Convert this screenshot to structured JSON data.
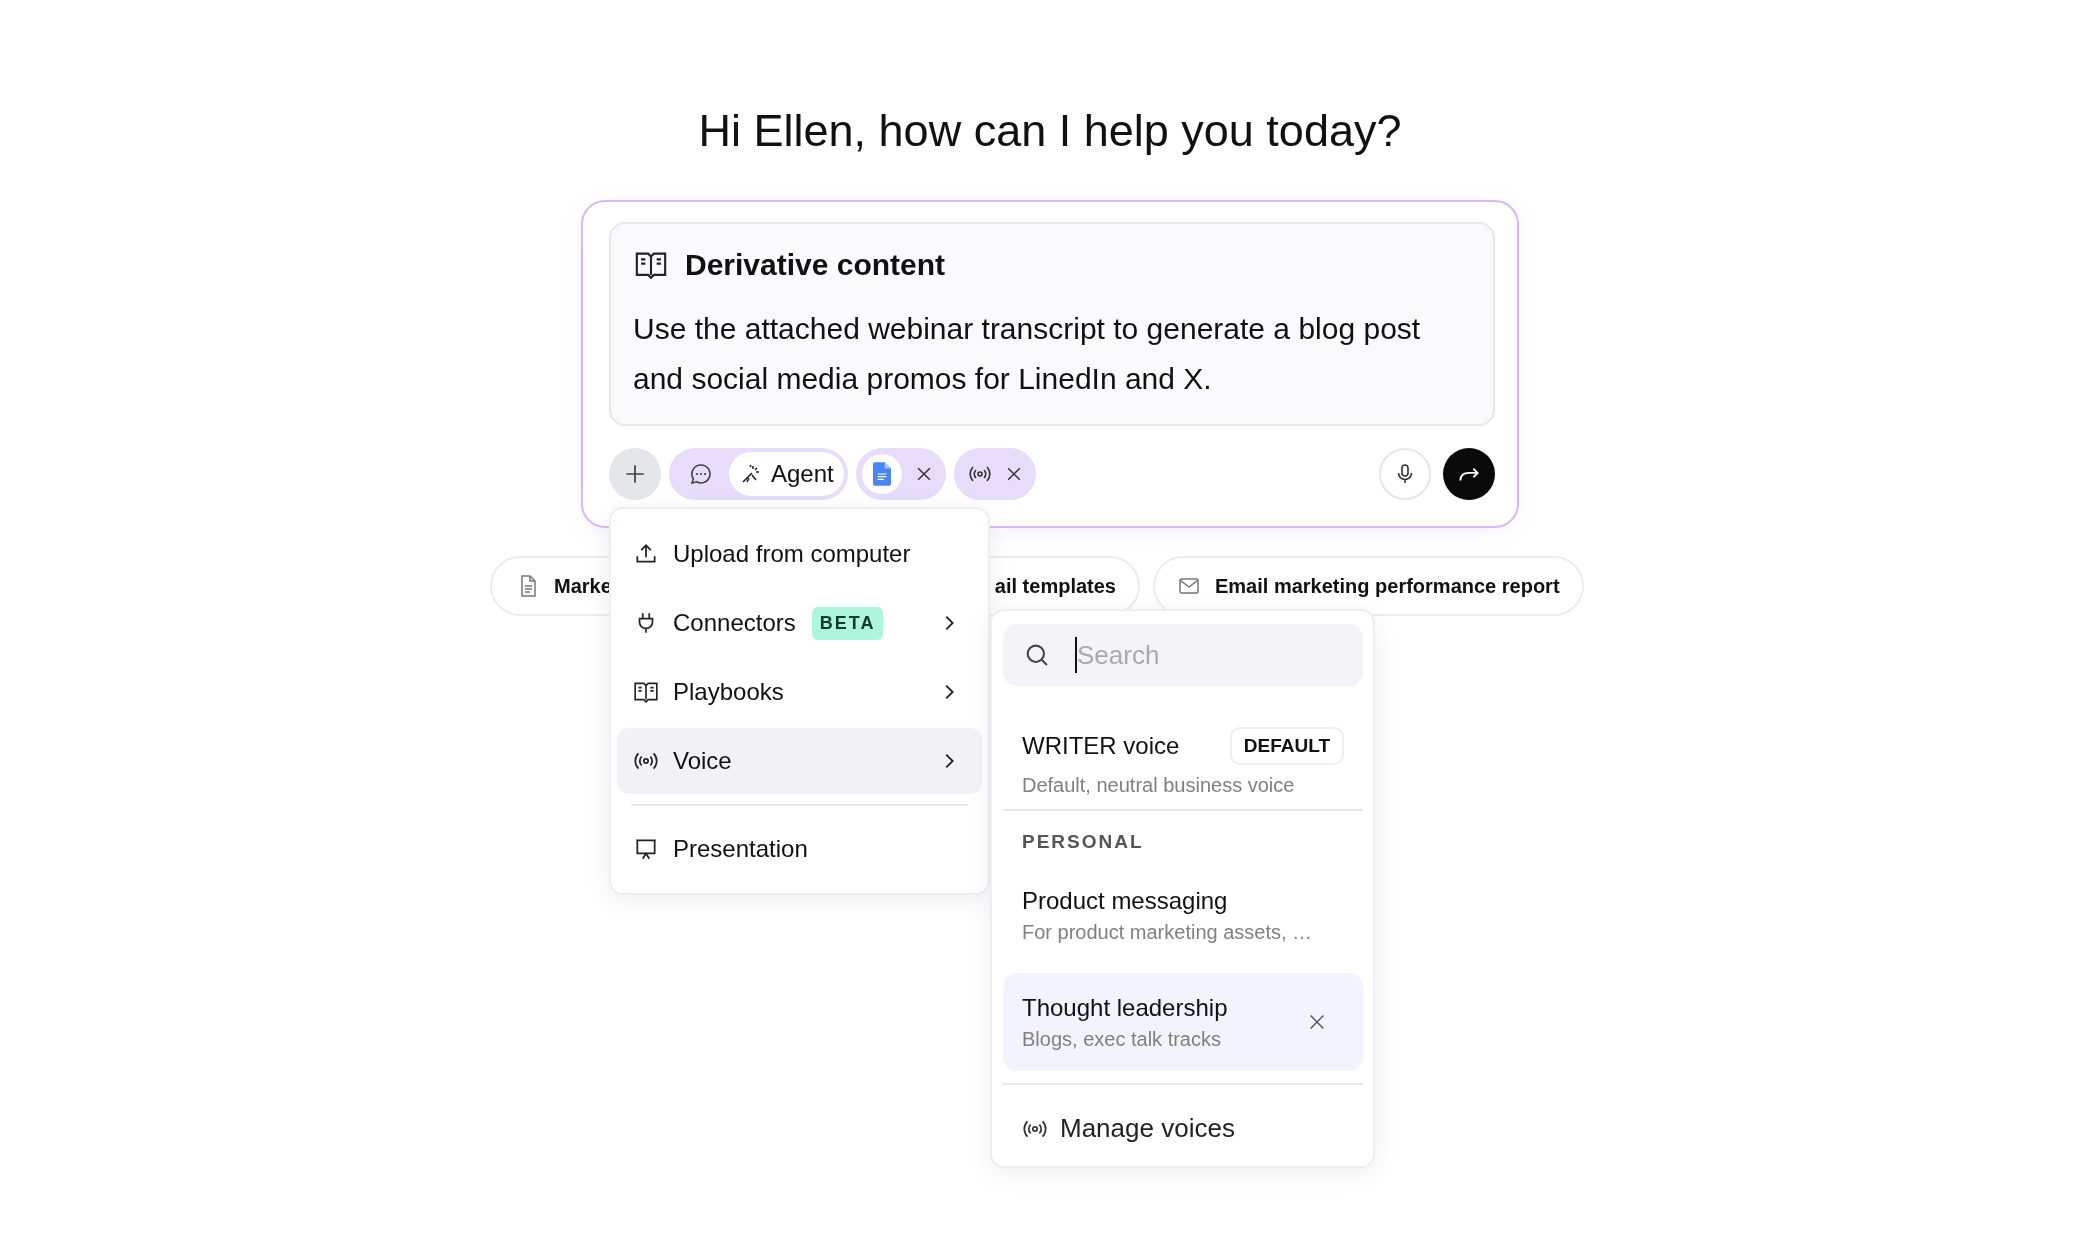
{
  "greeting": "Hi Ellen, how can I help you today?",
  "prompt_card": {
    "title": "Derivative content",
    "text": "Use the attached webinar transcript to generate a blog post and social media promos for LinedIn and X."
  },
  "toolbar": {
    "modes": [
      {
        "kind": "chat",
        "selected": false
      },
      {
        "kind": "agent",
        "label": "Agent",
        "selected": true
      }
    ],
    "attachments": [
      {
        "kind": "document"
      },
      {
        "kind": "voice"
      }
    ]
  },
  "suggestions": [
    {
      "kind": "document",
      "label": "Marke"
    },
    {
      "kind": "hidden",
      "label": "ail templates"
    },
    {
      "kind": "email",
      "label": "Email marketing performance report"
    }
  ],
  "add_menu": {
    "items": [
      {
        "kind": "upload",
        "label": "Upload from computer",
        "submenu": false,
        "selected": false
      },
      {
        "kind": "plug",
        "label": "Connectors",
        "badge": "BETA",
        "submenu": true,
        "selected": false
      },
      {
        "kind": "book",
        "label": "Playbooks",
        "submenu": true,
        "selected": false
      },
      {
        "kind": "voice",
        "label": "Voice",
        "submenu": true,
        "selected": true
      }
    ],
    "bottom_items": [
      {
        "kind": "presentation",
        "label": "Presentation",
        "submenu": false,
        "selected": false
      }
    ]
  },
  "voice_menu": {
    "search": {
      "placeholder": "Search"
    },
    "default_voice": {
      "name": "WRITER voice",
      "badge": "DEFAULT",
      "description": "Default, neutral business voice"
    },
    "section_label": "PERSONAL",
    "voices": [
      {
        "name": "Product messaging",
        "description": "For product marketing assets, …",
        "selected": false
      },
      {
        "name": "Thought leadership",
        "description": "Blogs, exec talk tracks",
        "selected": true
      }
    ],
    "footer": "Manage voices"
  }
}
